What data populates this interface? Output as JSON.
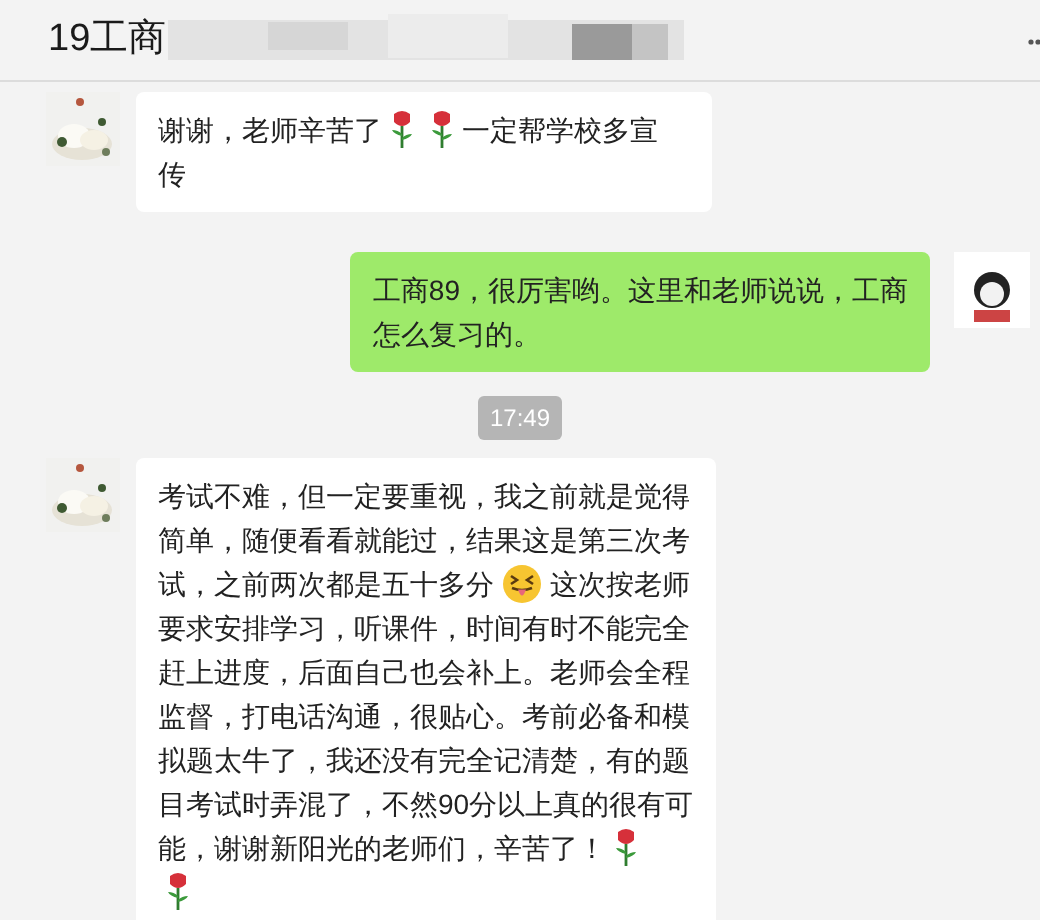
{
  "header": {
    "title": "19工商"
  },
  "items": [
    {
      "kind": "message",
      "outgoing": false,
      "lines": [
        [
          {
            "kind": "text",
            "text": "谢谢，老师辛苦了"
          },
          {
            "kind": "rose"
          },
          {
            "kind": "rose"
          },
          {
            "kind": "text",
            "text": "一定帮学校多宣"
          }
        ],
        [
          {
            "kind": "text",
            "text": "传"
          }
        ]
      ]
    },
    {
      "kind": "message",
      "outgoing": true,
      "lines": [
        [
          {
            "kind": "text",
            "text": "工商89，很厉害哟。这里和老师说说，工商"
          }
        ],
        [
          {
            "kind": "text",
            "text": "怎么复习的。"
          }
        ]
      ]
    },
    {
      "kind": "time",
      "text": "17:49"
    },
    {
      "kind": "message",
      "outgoing": false,
      "lines": [
        [
          {
            "kind": "text",
            "text": "考试不难，但一定要重视，我之前就是觉得"
          }
        ],
        [
          {
            "kind": "text",
            "text": "简单，随便看看就能过，结果这是第三次考"
          }
        ],
        [
          {
            "kind": "text",
            "text": "试，之前两次都是五十多分"
          },
          {
            "kind": "tongue"
          },
          {
            "kind": "text",
            "text": "这次按老师"
          }
        ],
        [
          {
            "kind": "text",
            "text": "要求安排学习，听课件，时间有时不能完全"
          }
        ],
        [
          {
            "kind": "text",
            "text": "赶上进度，后面自己也会补上。老师会全程"
          }
        ],
        [
          {
            "kind": "text",
            "text": "监督，打电话沟通，很贴心。考前必备和模"
          }
        ],
        [
          {
            "kind": "text",
            "text": "拟题太牛了，我还没有完全记清楚，有的题"
          }
        ],
        [
          {
            "kind": "text",
            "text": "目考试时弄混了，不然90分以上真的很有可"
          }
        ],
        [
          {
            "kind": "text",
            "text": "能，谢谢新阳光的老师们，辛苦了！"
          },
          {
            "kind": "rose"
          }
        ],
        [
          {
            "kind": "rose"
          }
        ]
      ]
    }
  ]
}
